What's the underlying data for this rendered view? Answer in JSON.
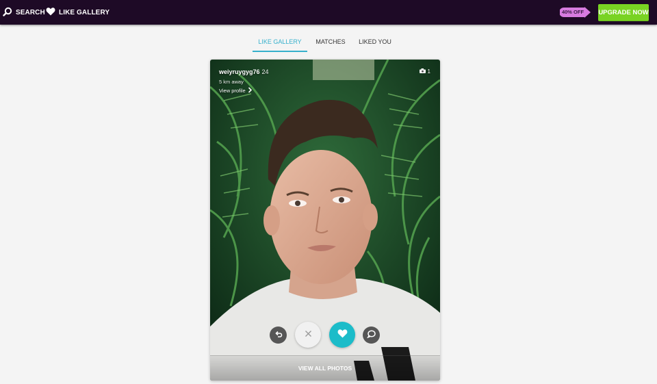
{
  "topbar": {
    "search_label": "SEARCH",
    "like_gallery_label": "LIKE GALLERY",
    "discount_label": "40% OFF",
    "upgrade_label": "UPGRADE NOW"
  },
  "tabs": [
    {
      "label": "LIKE GALLERY",
      "active": true
    },
    {
      "label": "MATCHES",
      "active": false
    },
    {
      "label": "LIKED YOU",
      "active": false
    }
  ],
  "profile": {
    "username": "weiyruygyg76",
    "age": "24",
    "distance": "5 km away",
    "view_profile_label": "View profile",
    "photo_count": "1"
  },
  "actions": {
    "view_all_photos_label": "VIEW ALL PHOTOS"
  },
  "colors": {
    "topbar_bg": "#1e0a26",
    "accent": "#36b0cc",
    "upgrade_green": "#79d323",
    "discount_pink": "#d77be0",
    "like_teal": "#1cbcc9"
  },
  "icons": [
    "search-icon",
    "heart-icon",
    "chevron-right-icon",
    "camera-icon",
    "undo-icon",
    "close-icon",
    "heart-icon",
    "chat-icon"
  ]
}
